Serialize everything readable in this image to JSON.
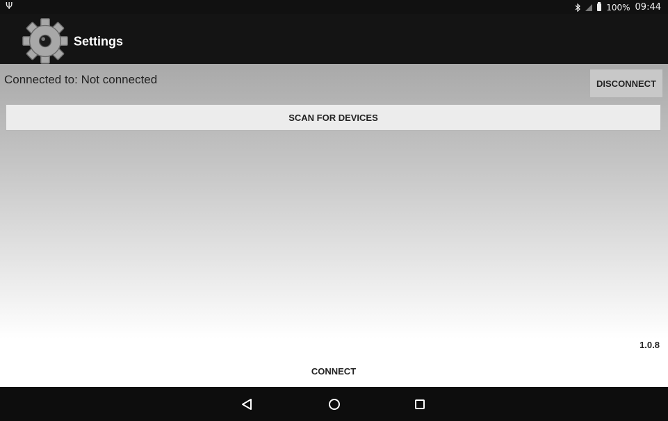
{
  "status_bar": {
    "usb_glyph": "Ψ",
    "battery_text": "100%",
    "time": "09:44",
    "icons": [
      "usb-icon",
      "bluetooth-icon",
      "signal-icon",
      "battery-icon"
    ]
  },
  "action_bar": {
    "title": "Settings",
    "icon": "gear-icon"
  },
  "connection": {
    "label": "Connected to: Not connected",
    "disconnect_label": "DISCONNECT"
  },
  "scan": {
    "label": "SCAN FOR DEVICES"
  },
  "footer": {
    "version": "1.0.8",
    "connect_label": "CONNECT"
  },
  "nav_bar": {
    "buttons": [
      "back-icon",
      "home-icon",
      "recents-icon"
    ]
  },
  "colors": {
    "bar_background": "#141414",
    "text": "#222222",
    "button_gray": "#c8c8c8"
  }
}
